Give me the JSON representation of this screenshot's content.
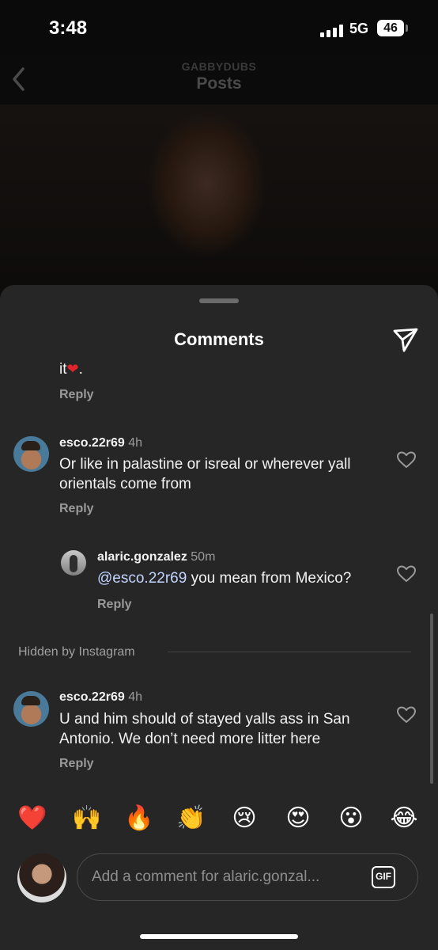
{
  "status_bar": {
    "time": "3:48",
    "network": "5G",
    "battery": "46"
  },
  "header": {
    "subtitle": "GABBYDUBS",
    "title": "Posts"
  },
  "sheet": {
    "title": "Comments"
  },
  "comments": [
    {
      "text_fragment": "it",
      "reply_label": "Reply"
    },
    {
      "username": "esco.22r69",
      "ago": "4h",
      "text": "Or like in palastine or isreal or wherever yall orientals come from",
      "reply_label": "Reply"
    },
    {
      "username": "alaric.gonzalez",
      "ago": "50m",
      "mention": "@esco.22r69",
      "text": " you mean from Mexico?",
      "reply_label": "Reply"
    },
    {
      "username": "esco.22r69",
      "ago": "4h",
      "text": "U and him should of stayed yalls ass in San Antonio. We don’t need more litter here",
      "reply_label": "Reply"
    }
  ],
  "hidden_label": "Hidden by Instagram",
  "reactions": [
    "❤️",
    "🙌",
    "🔥",
    "👏",
    "😢",
    "😍",
    "😮",
    "😂"
  ],
  "input": {
    "placeholder": "Add a comment for alaric.gonzal...",
    "gif_label": "GIF"
  }
}
